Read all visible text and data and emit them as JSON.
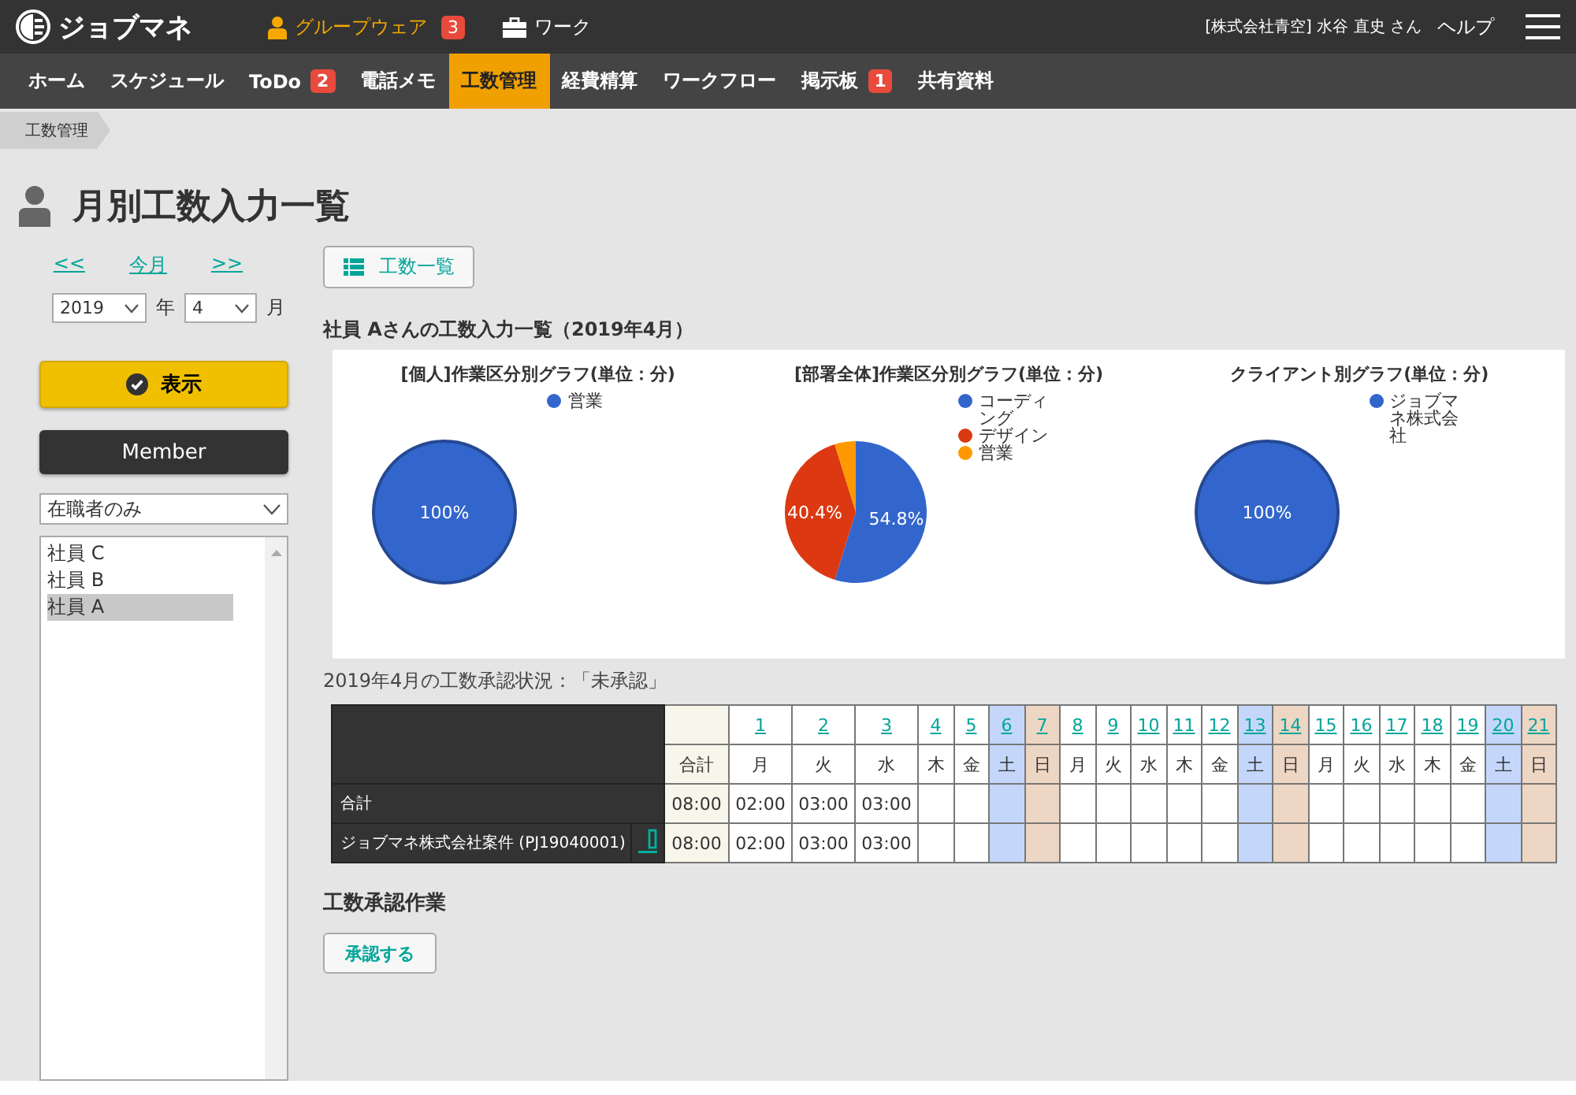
{
  "header": {
    "logo": "ジョブマネ",
    "groupware": {
      "label": "グループウェア",
      "badge": "3"
    },
    "work": "ワーク",
    "user": "[株式会社青空] 水谷 直史 さん",
    "help": "ヘルプ"
  },
  "nav": [
    {
      "label": "ホーム",
      "selected": false
    },
    {
      "label": "スケジュール",
      "selected": false
    },
    {
      "label": "ToDo",
      "selected": false,
      "badge": "2"
    },
    {
      "label": "電話メモ",
      "selected": false
    },
    {
      "label": "工数管理",
      "selected": true
    },
    {
      "label": "経費精算",
      "selected": false
    },
    {
      "label": "ワークフロー",
      "selected": false
    },
    {
      "label": "掲示板",
      "selected": false,
      "badge": "1"
    },
    {
      "label": "共有資料",
      "selected": false
    }
  ],
  "breadcrumb": "工数管理",
  "page_title": "月別工数入力一覧",
  "sidebar": {
    "prev": "<<",
    "current": "今月",
    "next": ">>",
    "year": "2019",
    "year_unit": "年",
    "month": "4",
    "month_unit": "月",
    "show_button": "表示",
    "member_heading": "Member",
    "filter": "在職者のみ",
    "members": [
      {
        "name": "社員 C",
        "selected": false
      },
      {
        "name": "社員 B",
        "selected": false
      },
      {
        "name": "社員 A",
        "selected": true
      }
    ]
  },
  "list_button": "工数一覧",
  "section_title": "社員 Aさんの工数入力一覧（2019年4月）",
  "charts": [
    {
      "chart_data": {
        "type": "pie",
        "title": "[個人]作業区分別グラフ(単位：分)",
        "categories": [
          "営業"
        ],
        "values": [
          100
        ],
        "colors": [
          "#3366cc"
        ],
        "value_labels": [
          "100%"
        ],
        "legend": "right"
      }
    },
    {
      "chart_data": {
        "type": "pie",
        "title": "[部署全体]作業区分別グラフ(単位：分)",
        "categories": [
          "コーディング",
          "デザイン",
          "営業"
        ],
        "values": [
          54.8,
          40.4,
          4.8
        ],
        "colors": [
          "#3366cc",
          "#dc3912",
          "#ff9900"
        ],
        "value_labels": [
          "54.8%",
          "40.4%",
          null
        ],
        "legend": "right"
      }
    },
    {
      "chart_data": {
        "type": "pie",
        "title": "クライアント別グラフ(単位：分)",
        "categories": [
          "ジョブマネ株式会社"
        ],
        "values": [
          100
        ],
        "colors": [
          "#3366cc"
        ],
        "value_labels": [
          "100%"
        ],
        "legend": "right"
      }
    }
  ],
  "approval_status": "2019年4月の工数承認状況：「未承認」",
  "table": {
    "total_header": "合計",
    "days": [
      {
        "day": "1",
        "weekday": "月",
        "kind": "weekday"
      },
      {
        "day": "2",
        "weekday": "火",
        "kind": "weekday"
      },
      {
        "day": "3",
        "weekday": "水",
        "kind": "weekday"
      },
      {
        "day": "4",
        "weekday": "木",
        "kind": "weekday"
      },
      {
        "day": "5",
        "weekday": "金",
        "kind": "weekday"
      },
      {
        "day": "6",
        "weekday": "土",
        "kind": "saturday"
      },
      {
        "day": "7",
        "weekday": "日",
        "kind": "sunday"
      },
      {
        "day": "8",
        "weekday": "月",
        "kind": "weekday"
      },
      {
        "day": "9",
        "weekday": "火",
        "kind": "weekday"
      },
      {
        "day": "10",
        "weekday": "水",
        "kind": "weekday"
      },
      {
        "day": "11",
        "weekday": "木",
        "kind": "weekday"
      },
      {
        "day": "12",
        "weekday": "金",
        "kind": "weekday"
      },
      {
        "day": "13",
        "weekday": "土",
        "kind": "saturday"
      },
      {
        "day": "14",
        "weekday": "日",
        "kind": "sunday"
      },
      {
        "day": "15",
        "weekday": "月",
        "kind": "weekday"
      },
      {
        "day": "16",
        "weekday": "火",
        "kind": "weekday"
      },
      {
        "day": "17",
        "weekday": "水",
        "kind": "weekday"
      },
      {
        "day": "18",
        "weekday": "木",
        "kind": "weekday"
      },
      {
        "day": "19",
        "weekday": "金",
        "kind": "weekday"
      },
      {
        "day": "20",
        "weekday": "土",
        "kind": "saturday"
      },
      {
        "day": "21",
        "weekday": "日",
        "kind": "sunday"
      }
    ],
    "rows": [
      {
        "label": "合計",
        "kind": "total",
        "total": "08:00",
        "values": [
          "02:00",
          "03:00",
          "03:00"
        ]
      },
      {
        "label": "ジョブマネ株式会社案件 (PJ19040001)",
        "kind": "project",
        "total": "08:00",
        "values": [
          "02:00",
          "03:00",
          "03:00"
        ]
      }
    ]
  },
  "approval_heading": "工数承認作業",
  "approve_button": "承認する"
}
